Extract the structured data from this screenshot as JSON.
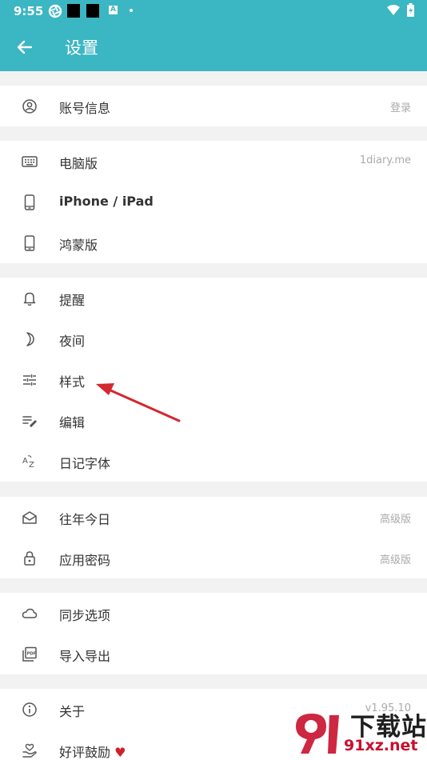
{
  "status_bar": {
    "time": "9:55"
  },
  "toolbar": {
    "title": "设置"
  },
  "groups": [
    [
      {
        "label": "账号信息",
        "trail": "登录",
        "icon": "account-circle-icon"
      }
    ],
    [
      {
        "label": "电脑版",
        "trail": "1diary.me",
        "icon": "keyboard-icon"
      },
      {
        "label": "iPhone / iPad",
        "trail": "",
        "icon": "phone-icon"
      },
      {
        "label": "鸿蒙版",
        "trail": "",
        "icon": "phone-icon"
      }
    ],
    [
      {
        "label": "提醒",
        "trail": "",
        "icon": "bell-icon"
      },
      {
        "label": "夜间",
        "trail": "",
        "icon": "moon-icon"
      },
      {
        "label": "样式",
        "trail": "",
        "icon": "sliders-icon"
      },
      {
        "label": "编辑",
        "trail": "",
        "icon": "edit-lines-icon"
      },
      {
        "label": "日记字体",
        "trail": "",
        "icon": "font-az-icon"
      }
    ],
    [
      {
        "label": "往年今日",
        "trail": "高级版",
        "icon": "mail-open-icon"
      },
      {
        "label": "应用密码",
        "trail": "高级版",
        "icon": "lock-icon"
      }
    ],
    [
      {
        "label": "同步选项",
        "trail": "",
        "icon": "cloud-icon"
      },
      {
        "label": "导入导出",
        "trail": "",
        "icon": "pdf-icon"
      }
    ],
    [
      {
        "label": "关于",
        "trail": "v1.95.10",
        "icon": "info-icon"
      },
      {
        "label": "好评鼓励",
        "trail": "",
        "icon": "hand-heart-icon"
      }
    ]
  ],
  "rate_heart": "♥",
  "watermark": {
    "main": "下载站",
    "sub": "91xz.net"
  },
  "colors": {
    "appbar": "#3bb6c3",
    "annotation_arrow": "#d3282f"
  }
}
